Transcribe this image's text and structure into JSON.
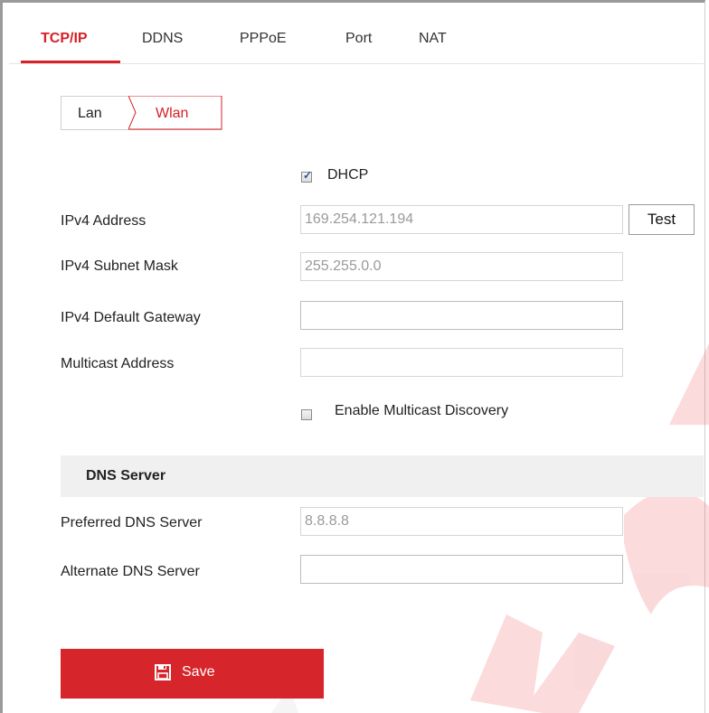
{
  "tabs": [
    {
      "label": "TCP/IP",
      "active": true
    },
    {
      "label": "DDNS",
      "active": false
    },
    {
      "label": "PPPoE",
      "active": false
    },
    {
      "label": "Port",
      "active": false
    },
    {
      "label": "NAT",
      "active": false
    }
  ],
  "subtabs": [
    {
      "label": "Lan",
      "active": false
    },
    {
      "label": "Wlan",
      "active": true
    }
  ],
  "form": {
    "dhcp_label": "DHCP",
    "dhcp_checked": true,
    "ipv4_address_label": "IPv4 Address",
    "ipv4_address_value": "169.254.121.194",
    "test_label": "Test",
    "ipv4_subnet_label": "IPv4 Subnet Mask",
    "ipv4_subnet_value": "255.255.0.0",
    "ipv4_gateway_label": "IPv4 Default Gateway",
    "ipv4_gateway_value": "",
    "multicast_label": "Multicast Address",
    "multicast_value": "",
    "enable_multicast_label": "Enable Multicast Discovery",
    "enable_multicast_checked": false
  },
  "dns": {
    "section_title": "DNS Server",
    "preferred_label": "Preferred DNS Server",
    "preferred_value": "8.8.8.8",
    "alternate_label": "Alternate DNS Server",
    "alternate_value": ""
  },
  "save": {
    "label": "Save",
    "icon": "floppy-disk-icon"
  },
  "colors": {
    "accent": "#d72027",
    "save_bg": "#d7262b"
  }
}
